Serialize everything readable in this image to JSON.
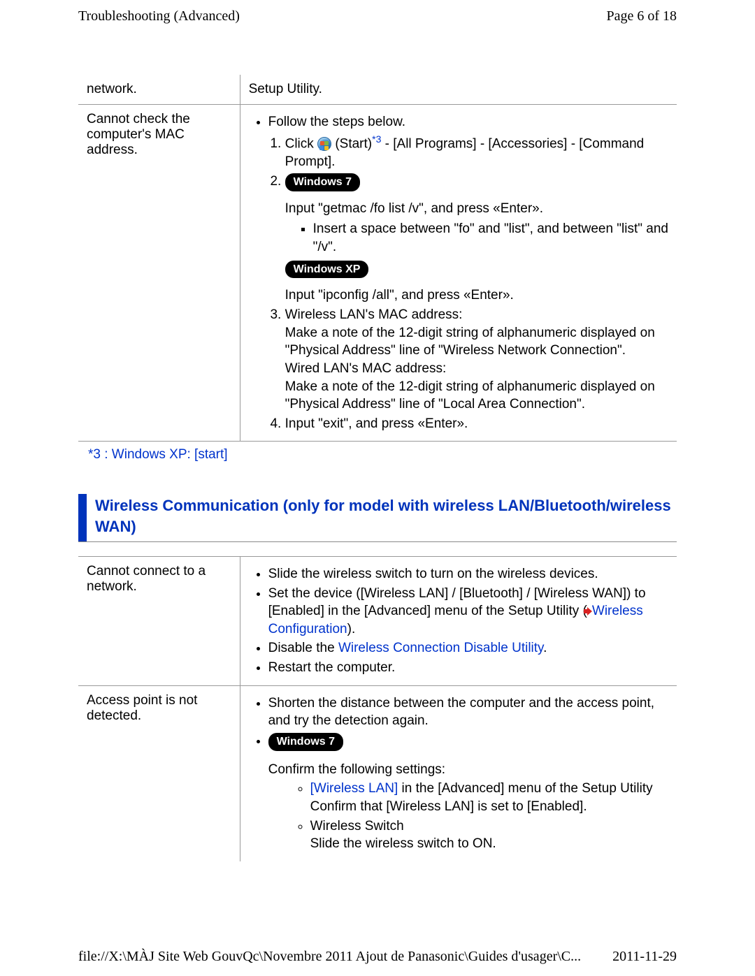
{
  "header": {
    "title": "Troubleshooting (Advanced)",
    "page_info": "Page 6 of 18"
  },
  "table1": {
    "row1": {
      "label": "network.",
      "content": "Setup Utility."
    },
    "row2": {
      "label": "Cannot check the computer's MAC address.",
      "bullet1": "Follow the steps below.",
      "step1_prefix": "Click ",
      "step1_after_icon": " (Start)",
      "step1_sup": "*3",
      "step1_rest": " - [All Programs] - [Accessories] - [Command Prompt].",
      "badge_win7": "Windows 7",
      "step2_text1": "Input \"getmac /fo list /v\", and press «Enter».",
      "step2_sub": "Insert a space between \"fo\" and \"list\", and between \"list\" and \"/v\".",
      "badge_winxp": "Windows XP",
      "step2_text2": "Input \"ipconfig /all\", and press «Enter».",
      "step3_line1": "Wireless LAN's MAC address:",
      "step3_line2": "Make a note of the 12-digit string of alphanumeric displayed on \"Physical Address\" line of \"Wireless Network Connection\".",
      "step3_line3": "Wired LAN's MAC address:",
      "step3_line4": "Make a note of the 12-digit string of alphanumeric displayed on \"Physical Address\" line of \"Local Area Connection\".",
      "step4": "Input \"exit\", and press «Enter»."
    }
  },
  "footnote": "*3 : Windows XP: [start]",
  "section_heading": "Wireless Communication (only for model with wireless LAN/Bluetooth/wireless WAN)",
  "table2": {
    "row1": {
      "label": "Cannot connect to a network.",
      "b1": "Slide the wireless switch to turn on the wireless devices.",
      "b2_pre": "Set the device ([Wireless LAN] / [Bluetooth] / [Wireless WAN]) to [Enabled] in the [Advanced] menu of the Setup Utility (",
      "b2_link": "Wireless Configuration",
      "b2_post": ").",
      "b3_pre": "Disable the ",
      "b3_link": "Wireless Connection Disable Utility",
      "b3_post": ".",
      "b4": "Restart the computer."
    },
    "row2": {
      "label": "Access point is not detected.",
      "b1": "Shorten the distance between the computer and the access point, and try the detection again.",
      "badge_win7": "Windows 7",
      "confirm": "Confirm the following settings:",
      "s1_link": "[Wireless LAN]",
      "s1_rest": " in the [Advanced] menu of the Setup Utility",
      "s1_line2": "Confirm that [Wireless LAN] is set to [Enabled].",
      "s2_line1": "Wireless Switch",
      "s2_line2": "Slide the wireless switch to ON."
    }
  },
  "footer": {
    "path": "file://X:\\MÀJ Site Web GouvQc\\Novembre 2011 Ajout de Panasonic\\Guides d'usager\\C...",
    "date": "2011-11-29"
  }
}
